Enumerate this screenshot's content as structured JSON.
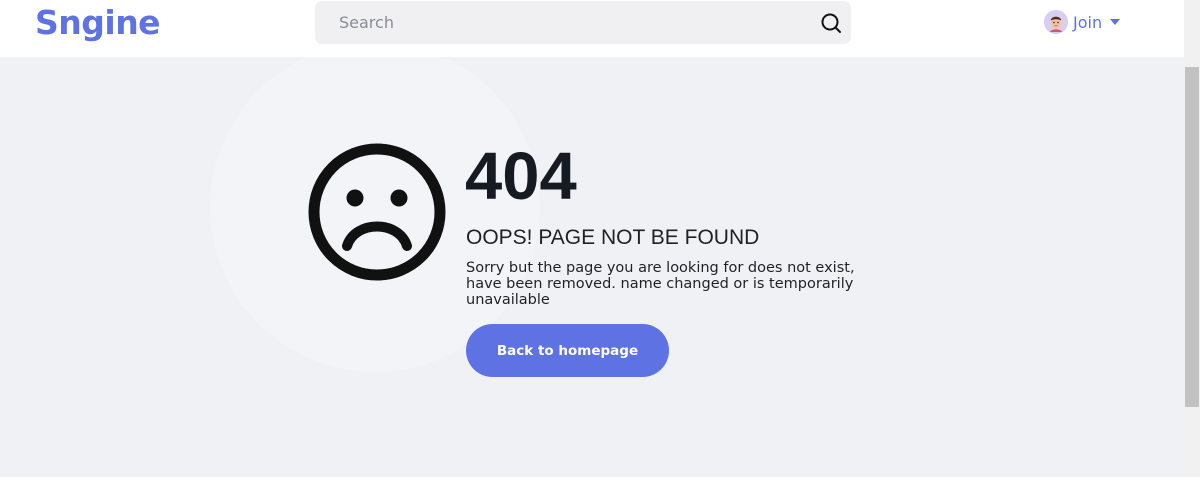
{
  "header": {
    "logo": "Sngine",
    "search": {
      "placeholder": "Search",
      "value": ""
    },
    "user_menu": {
      "label": "Join"
    }
  },
  "error": {
    "code": "404",
    "title": "OOPS! PAGE NOT BE FOUND",
    "message": "Sorry but the page you are looking for does not exist, have been removed. name changed or is temporarily unavailable",
    "button_label": "Back to homepage"
  },
  "colors": {
    "brand": "#5e72e4",
    "background": "#f0f1f5",
    "text": "#161a22"
  },
  "icons": {
    "search": "search-icon",
    "avatar": "avatar",
    "caret": "caret-down-icon",
    "sad_face": "sad-face-icon"
  }
}
